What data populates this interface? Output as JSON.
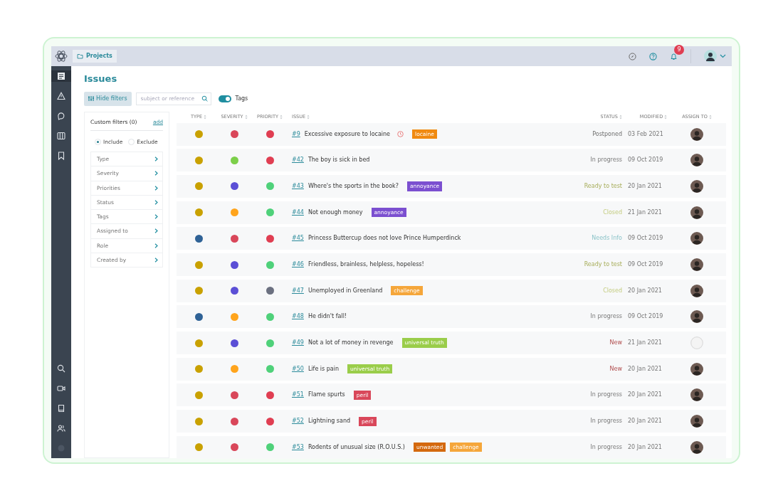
{
  "topbar": {
    "breadcrumb": "Projects",
    "notifications": "9"
  },
  "page": {
    "title": "Issues"
  },
  "toolbar": {
    "hide_filters": "Hide filters",
    "search": {
      "placeholder": "subject or reference"
    },
    "tags_toggle": {
      "label": "Tags",
      "on": true
    }
  },
  "filters": {
    "title": "Custom filters",
    "count": "(0)",
    "add": "add",
    "modes": [
      {
        "label": "Include",
        "selected": true
      },
      {
        "label": "Exclude",
        "selected": false
      }
    ],
    "items": [
      "Type",
      "Severity",
      "Priorities",
      "Status",
      "Tags",
      "Assigned to",
      "Role",
      "Created by"
    ]
  },
  "table": {
    "columns": [
      "TYPE",
      "SEVERITY",
      "PRIORITY",
      "ISSUE",
      "STATUS",
      "MODIFIED",
      "ASSIGN TO"
    ],
    "rows": [
      {
        "type": {
          "color": "#c9a100"
        },
        "severity": {
          "color": "#d9475a"
        },
        "priority": {
          "color": "#e03e52"
        },
        "ref": "#9",
        "subject": "Excessive exposure to locaine",
        "overdue": true,
        "tags": [
          {
            "label": "locaine",
            "color": "#f08a10"
          }
        ],
        "status": {
          "label": "Postponed",
          "kind": "postponed"
        },
        "modified": "03 Feb 2021",
        "assigned": true
      },
      {
        "type": {
          "color": "#c9a100"
        },
        "severity": {
          "color": "#7ccf4a"
        },
        "priority": {
          "color": "#e03e52"
        },
        "ref": "#42",
        "subject": "The boy is sick in bed",
        "overdue": false,
        "tags": [],
        "status": {
          "label": "In progress",
          "kind": "progress"
        },
        "modified": "09 Oct 2019",
        "assigned": true
      },
      {
        "type": {
          "color": "#c9a100"
        },
        "severity": {
          "color": "#5b4fd6"
        },
        "priority": {
          "color": "#4fd17a"
        },
        "ref": "#43",
        "subject": "Where's the sports in the book?",
        "overdue": false,
        "tags": [
          {
            "label": "annoyance",
            "color": "#7b4fd0"
          }
        ],
        "status": {
          "label": "Ready to test",
          "kind": "ready"
        },
        "modified": "20 Jan 2021",
        "assigned": true
      },
      {
        "type": {
          "color": "#c9a100"
        },
        "severity": {
          "color": "#ffa41c"
        },
        "priority": {
          "color": "#4fd17a"
        },
        "ref": "#44",
        "subject": "Not enough money",
        "overdue": false,
        "tags": [
          {
            "label": "annoyance",
            "color": "#7b4fd0"
          }
        ],
        "status": {
          "label": "Closed",
          "kind": "closed"
        },
        "modified": "21 Jan 2021",
        "assigned": true
      },
      {
        "type": {
          "color": "#2f6296"
        },
        "severity": {
          "color": "#d9475a"
        },
        "priority": {
          "color": "#e03e52"
        },
        "ref": "#45",
        "subject": "Princess Buttercup does not love Prince Humperdinck",
        "overdue": false,
        "tags": [],
        "status": {
          "label": "Needs Info",
          "kind": "info"
        },
        "modified": "09 Oct 2019",
        "assigned": true
      },
      {
        "type": {
          "color": "#c9a100"
        },
        "severity": {
          "color": "#5b4fd6"
        },
        "priority": {
          "color": "#4fd17a"
        },
        "ref": "#46",
        "subject": "Friendless, brainless, helpless, hopeless!",
        "overdue": false,
        "tags": [],
        "status": {
          "label": "Ready to test",
          "kind": "ready"
        },
        "modified": "09 Oct 2019",
        "assigned": true
      },
      {
        "type": {
          "color": "#c9a100"
        },
        "severity": {
          "color": "#5b4fd6"
        },
        "priority": {
          "color": "#6b7080"
        },
        "ref": "#47",
        "subject": "Unemployed in Greenland",
        "overdue": false,
        "tags": [
          {
            "label": "challenge",
            "color": "#f5a63a"
          }
        ],
        "status": {
          "label": "Closed",
          "kind": "closed"
        },
        "modified": "20 Jan 2021",
        "assigned": true
      },
      {
        "type": {
          "color": "#2f6296"
        },
        "severity": {
          "color": "#ffa41c"
        },
        "priority": {
          "color": "#4fd17a"
        },
        "ref": "#48",
        "subject": "He didn't fall!",
        "overdue": false,
        "tags": [],
        "status": {
          "label": "In progress",
          "kind": "progress"
        },
        "modified": "09 Oct 2019",
        "assigned": true
      },
      {
        "type": {
          "color": "#c9a100"
        },
        "severity": {
          "color": "#5b4fd6"
        },
        "priority": {
          "color": "#4fd17a"
        },
        "ref": "#49",
        "subject": "Not a lot of money in revenge",
        "overdue": false,
        "tags": [
          {
            "label": "universal truth",
            "color": "#9acd4a"
          }
        ],
        "status": {
          "label": "New",
          "kind": "new"
        },
        "modified": "21 Jan 2021",
        "assigned": false
      },
      {
        "type": {
          "color": "#c9a100"
        },
        "severity": {
          "color": "#ffa41c"
        },
        "priority": {
          "color": "#4fd17a"
        },
        "ref": "#50",
        "subject": "Life is pain",
        "overdue": false,
        "tags": [
          {
            "label": "universal truth",
            "color": "#9acd4a"
          }
        ],
        "status": {
          "label": "New",
          "kind": "new"
        },
        "modified": "20 Jan 2021",
        "assigned": true
      },
      {
        "type": {
          "color": "#c9a100"
        },
        "severity": {
          "color": "#d9475a"
        },
        "priority": {
          "color": "#e03e52"
        },
        "ref": "#51",
        "subject": "Flame spurts",
        "overdue": false,
        "tags": [
          {
            "label": "peril",
            "color": "#d9475a"
          }
        ],
        "status": {
          "label": "In progress",
          "kind": "progress"
        },
        "modified": "20 Jan 2021",
        "assigned": true
      },
      {
        "type": {
          "color": "#c9a100"
        },
        "severity": {
          "color": "#d9475a"
        },
        "priority": {
          "color": "#e03e52"
        },
        "ref": "#52",
        "subject": "Lightning sand",
        "overdue": false,
        "tags": [
          {
            "label": "peril",
            "color": "#d9475a"
          }
        ],
        "status": {
          "label": "In progress",
          "kind": "progress"
        },
        "modified": "20 Jan 2021",
        "assigned": true
      },
      {
        "type": {
          "color": "#c9a100"
        },
        "severity": {
          "color": "#d9475a"
        },
        "priority": {
          "color": "#4fd17a"
        },
        "ref": "#53",
        "subject": "Rodents of unusual size (R.O.U.S.)",
        "overdue": false,
        "tags": [
          {
            "label": "unwanted",
            "color": "#d4690e"
          },
          {
            "label": "challenge",
            "color": "#f5a63a"
          }
        ],
        "status": {
          "label": "In progress",
          "kind": "progress"
        },
        "modified": "20 Jan 2021",
        "assigned": true
      }
    ]
  }
}
